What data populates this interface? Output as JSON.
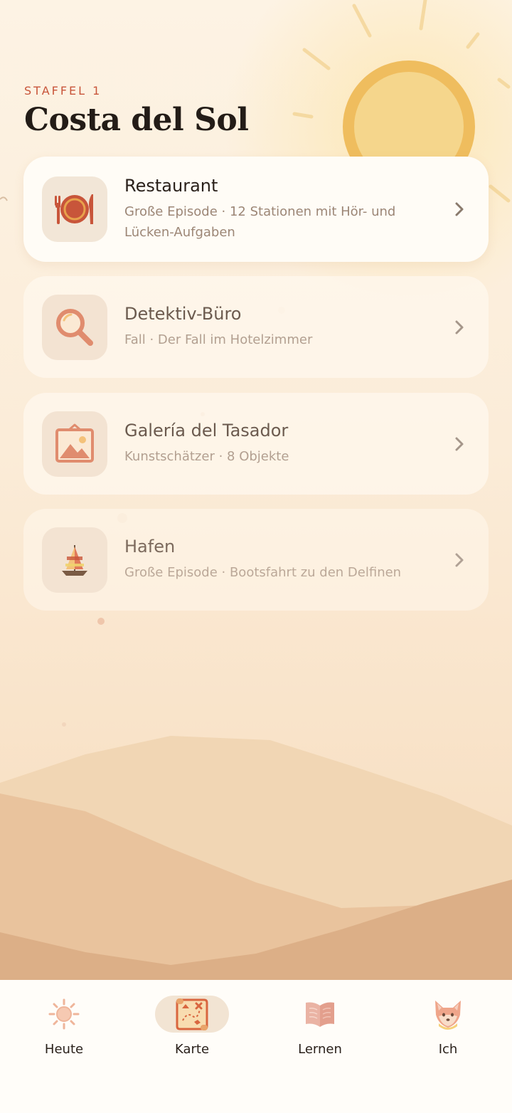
{
  "header": {
    "season_label": "STAFFEL 1",
    "title": "Costa del Sol"
  },
  "episodes": [
    {
      "title": "Restaurant",
      "subtitle_line1": "Große Episode · 12 Stationen mit Hör- und",
      "subtitle_line2": "Lücken-Aufgaben",
      "icon": "plate-cutlery-icon",
      "state": "available"
    },
    {
      "title": "Detektiv-Büro",
      "subtitle_line1": "Fall · Der Fall im Hotelzimmer",
      "icon": "magnifier-icon",
      "state": "locked"
    },
    {
      "title": "Galería del Tasador",
      "subtitle_line1": "Kunstschätzer · 8 Objekte",
      "icon": "framed-picture-icon",
      "state": "locked"
    },
    {
      "title": "Hafen",
      "subtitle_line1": "Große Episode · Bootsfahrt zu den Delfinen",
      "icon": "sailboat-icon",
      "state": "locked"
    }
  ],
  "nav": {
    "items": [
      {
        "label": "Heute",
        "icon": "sun-icon"
      },
      {
        "label": "Karte",
        "icon": "treasure-map-icon",
        "active": true
      },
      {
        "label": "Lernen",
        "icon": "open-book-icon"
      },
      {
        "label": "Ich",
        "icon": "fox-icon"
      }
    ]
  },
  "colors": {
    "accent": "#c8553a",
    "title": "#231c17",
    "sun": "#f2c870",
    "dune_light": "#f0d2ae",
    "dune_dark": "#deae86"
  }
}
